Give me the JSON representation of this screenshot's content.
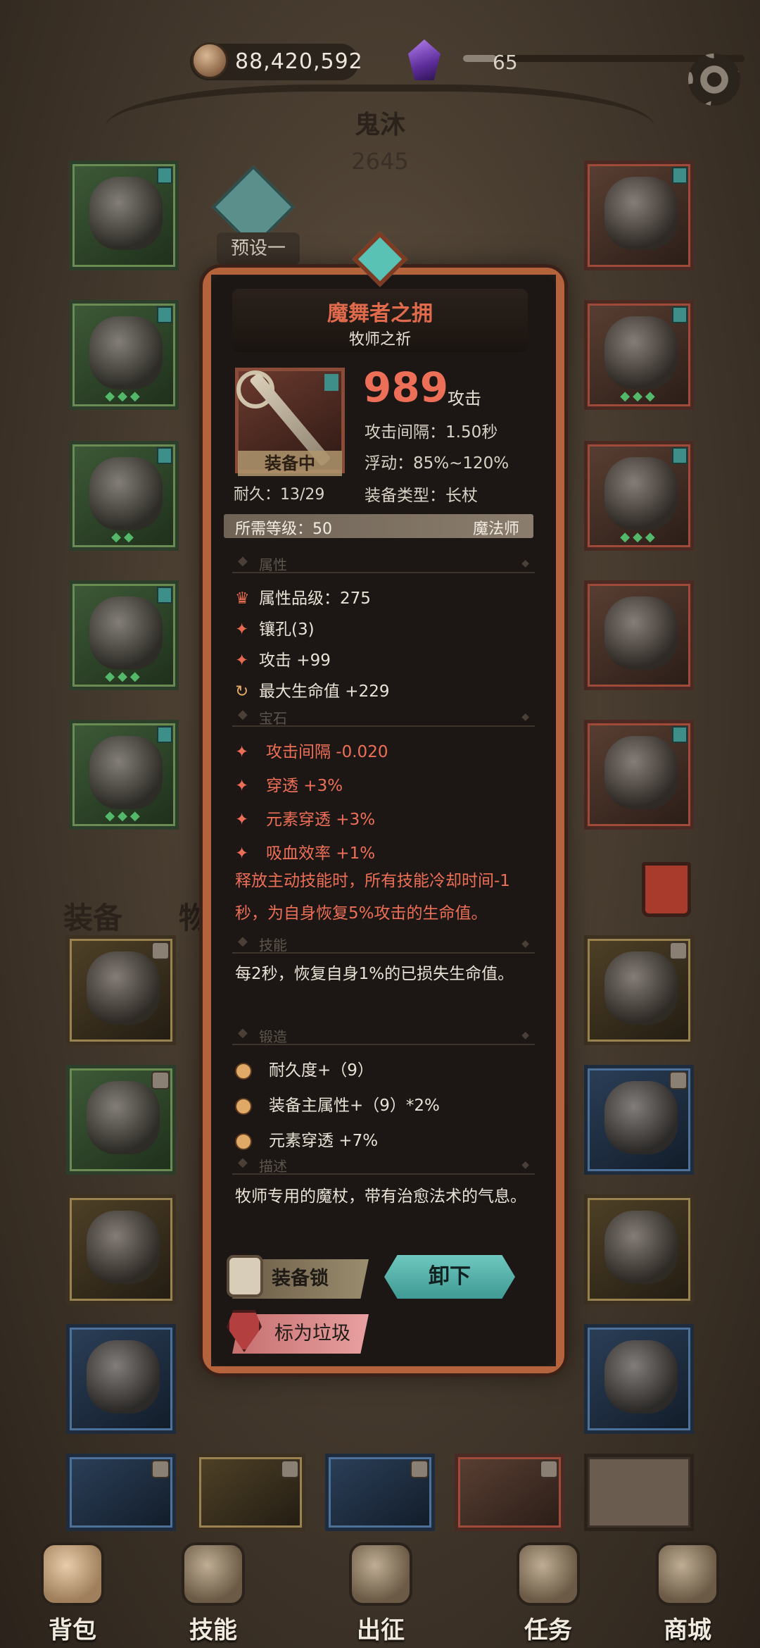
{
  "top_bar": {
    "coins": "88,420,592",
    "energy_value": "65",
    "energy_fill_fraction": 0.12,
    "coin_icon": "coin-icon",
    "gem_icon": "purple-gem-icon",
    "settings_icon": "gear-icon"
  },
  "character": {
    "name": "鬼沐",
    "power": "2645",
    "preset_label": "预设一"
  },
  "bag_tabs": {
    "equipment": "装备",
    "items": "物品"
  },
  "tooltip": {
    "name": "魔舞者之拥",
    "subtitle": "牧师之祈",
    "equipped_label": "装备中",
    "durability": "耐久：13/29",
    "attack_value": "989",
    "attack_label": "攻击",
    "stats": [
      "攻击间隔：1.50秒",
      "浮动：85%~120%",
      "装备类型：长杖"
    ],
    "required_level": "所需等级：50",
    "required_class": "魔法师",
    "sections": {
      "attributes": "属性",
      "gems": "宝石",
      "skill": "技能",
      "forge": "锻造",
      "description": "描述"
    },
    "attributes": [
      {
        "icon": "crown-icon",
        "text": "属性品级：275"
      },
      {
        "icon": "diamond-icon",
        "text": "镶孔(3)"
      },
      {
        "icon": "diamond-icon",
        "text": "攻击 +99"
      },
      {
        "icon": "refresh-icon",
        "text": "最大生命值 +229"
      }
    ],
    "gem_stats": [
      "攻击间隔 -0.020",
      "穿透 +3%",
      "元素穿透 +3%",
      "吸血效率 +1%"
    ],
    "gem_bonus": "释放主动技能时，所有技能冷却时间-1秒，为自身恢复5%攻击的生命值。",
    "skill_text": "每2秒，恢复自身1%的已损失生命值。",
    "forge_stats": [
      "耐久度+（9）",
      "装备主属性+（9）*2%",
      "元素穿透 +7%"
    ],
    "description_text": "牧师专用的魔杖，带有治愈法术的气息。",
    "lock_button": "装备锁",
    "unequip_button": "卸下",
    "junk_button": "标为垃圾"
  },
  "bottom_nav": [
    {
      "label": "背包",
      "icon": "bag-icon"
    },
    {
      "label": "技能",
      "icon": "skill-book-icon"
    },
    {
      "label": "出征",
      "icon": "map-icon"
    },
    {
      "label": "任务",
      "icon": "quest-scroll-icon"
    },
    {
      "label": "商城",
      "icon": "shop-crown-icon"
    }
  ],
  "colors": {
    "accent_red": "#ee6f57",
    "teal_button": "#4fb0a8",
    "frame_orange": "#b4633c"
  }
}
